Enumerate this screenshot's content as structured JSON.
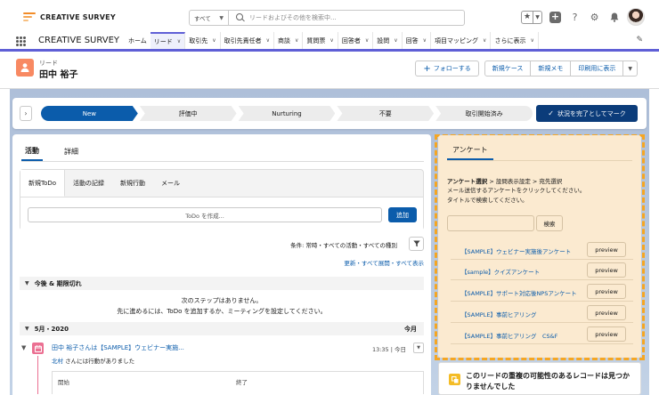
{
  "brand": {
    "name": "CREATIVE SURVEY"
  },
  "search": {
    "scope": "すべて",
    "placeholder": "リードおよびその他を検索中..."
  },
  "nav": {
    "app_name": "CREATIVE SURVEY",
    "items": [
      {
        "label": "ホーム",
        "chevron": false,
        "active": false
      },
      {
        "label": "リード",
        "chevron": true,
        "active": true
      },
      {
        "label": "取引先",
        "chevron": true,
        "active": false
      },
      {
        "label": "取引先責任者",
        "chevron": true,
        "active": false
      },
      {
        "label": "商談",
        "chevron": true,
        "active": false
      },
      {
        "label": "質問票",
        "chevron": true,
        "active": false
      },
      {
        "label": "回答者",
        "chevron": true,
        "active": false
      },
      {
        "label": "設問",
        "chevron": true,
        "active": false
      },
      {
        "label": "回答",
        "chevron": true,
        "active": false
      },
      {
        "label": "項目マッピング",
        "chevron": true,
        "active": false
      },
      {
        "label": "さらに表示",
        "chevron": true,
        "active": false
      }
    ]
  },
  "record": {
    "type": "リード",
    "name": "田中 裕子",
    "follow_label": "フォローする",
    "actions": [
      "新規ケース",
      "新規メモ",
      "印刷用に表示"
    ]
  },
  "path": {
    "stages": [
      "New",
      "評価中",
      "Nurturing",
      "不要",
      "取引開始済み"
    ],
    "current_index": 0,
    "complete_label": "状況を完了としてマーク"
  },
  "activity": {
    "tabs": [
      "活動",
      "詳細"
    ],
    "composer_tabs": [
      "新規ToDo",
      "活動の記録",
      "新規行動",
      "メール"
    ],
    "todo_placeholder": "ToDo を作成...",
    "add_label": "追加",
    "filter_text": "条件: 常時・すべての活動・すべての種別",
    "links_text": "更新・すべて展開・すべて表示",
    "upcoming_label": "今後 & 期限切れ",
    "empty_line1": "次のステップはありません。",
    "empty_line2": "先に進めるには、ToDo を追加するか、ミーティングを設定してください。",
    "month_label": "5月・2020",
    "month_right": "今月",
    "item_title": "田中 裕子さんは【SAMPLE】ウェビナー実施...",
    "item_time": "13:35 | 今日",
    "item_actor": "北村",
    "item_action": " さんには行動がありました",
    "col_start": "開始",
    "col_end": "終了"
  },
  "survey": {
    "tab_label": "アンケート",
    "crumb_bold": "アンケート選択",
    "crumb_rest": " > 設問表示設定 > 宛先選択",
    "help_line1": "メール送信するアンケートをクリックしてください。",
    "help_line2": "タイトルで検索してください。",
    "search_label": "検索",
    "preview_label": "preview",
    "items": [
      "【SAMPLE】ウェビナー実施後アンケート",
      "【sample】クイズアンケート",
      "【SAMPLE】サポート対応後NPSアンケート",
      "【SAMPLE】事前ヒアリング",
      "【SAMPLE】事前ヒアリング　CS&F"
    ]
  },
  "duplicates": {
    "text": "このリードの重複の可能性のあるレコードは見つかりませんでした"
  },
  "colors": {
    "brand_orange": "#f28c28",
    "primary_blue": "#0b5cab",
    "nav_accent": "#5f5fd6",
    "lead_icon": "#f88962",
    "survey_bg": "#fbead0",
    "dashed_border": "#f5a623"
  }
}
